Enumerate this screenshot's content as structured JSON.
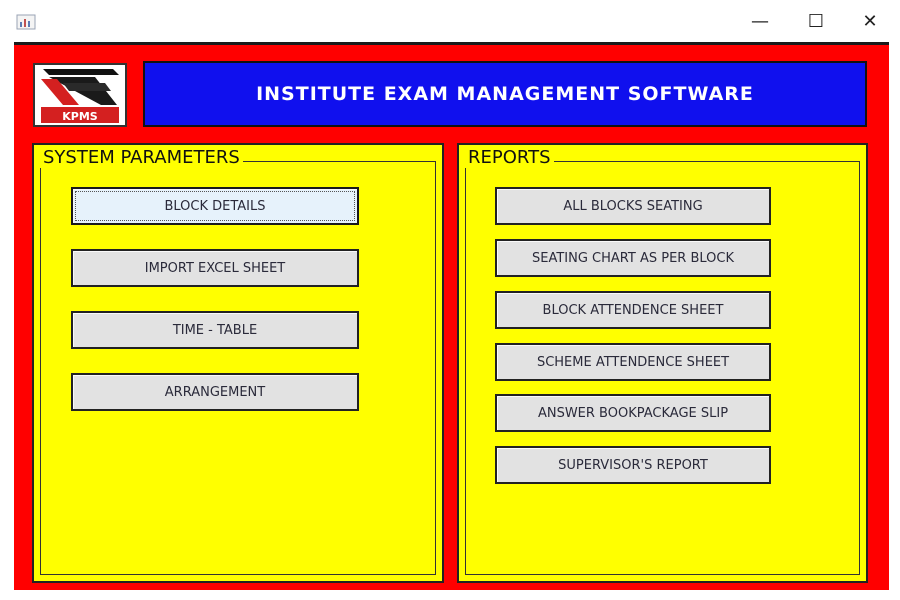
{
  "window": {
    "minimize_glyph": "—",
    "maximize_glyph": "☐",
    "close_glyph": "✕"
  },
  "header": {
    "title": "INSTITUTE EXAM MANAGEMENT SOFTWARE",
    "logo_text": "KPMS"
  },
  "system_parameters": {
    "title": "SYSTEM PARAMETERS",
    "buttons": [
      {
        "label": "BLOCK DETAILS"
      },
      {
        "label": "IMPORT EXCEL SHEET"
      },
      {
        "label": "TIME - TABLE"
      },
      {
        "label": "ARRANGEMENT"
      }
    ]
  },
  "reports": {
    "title": "REPORTS",
    "buttons": [
      {
        "label": "ALL BLOCKS SEATING"
      },
      {
        "label": "SEATING CHART AS PER BLOCK"
      },
      {
        "label": "BLOCK ATTENDENCE SHEET"
      },
      {
        "label": "SCHEME ATTENDENCE SHEET"
      },
      {
        "label": "ANSWER BOOKPACKAGE SLIP"
      },
      {
        "label": "SUPERVISOR'S REPORT"
      }
    ]
  },
  "colors": {
    "frame": "#ff0000",
    "header_band": "#1010ee",
    "panel": "#ffff00",
    "button": "#e2e2e2"
  }
}
